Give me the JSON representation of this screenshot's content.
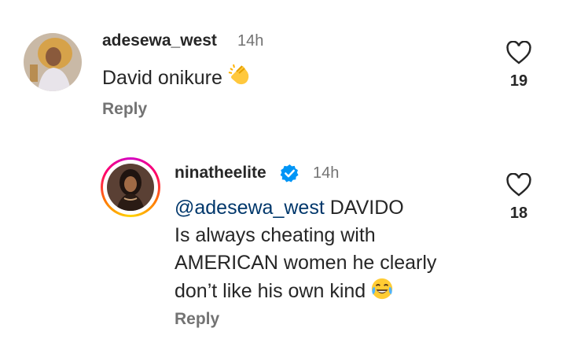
{
  "comments": [
    {
      "username": "adesewa_west",
      "time": "14h",
      "text": "David onikure",
      "emoji": "clapping-hands-emoji",
      "reply_label": "Reply",
      "likes": "19",
      "verified": false
    },
    {
      "username": "ninatheelite",
      "time": "14h",
      "mention": "@adesewa_west",
      "text_line1": "DAVIDO",
      "text_line2": "Is always cheating with",
      "text_line3": "AMERICAN women he clearly",
      "text_line4": "don’t like his own kind",
      "emoji": "tears-of-joy-emoji",
      "reply_label": "Reply",
      "likes": "18",
      "verified": true,
      "story_ring": true
    }
  ],
  "colors": {
    "text": "#262626",
    "secondary": "#737373",
    "mention": "#00376b",
    "verified": "#0095f6"
  }
}
